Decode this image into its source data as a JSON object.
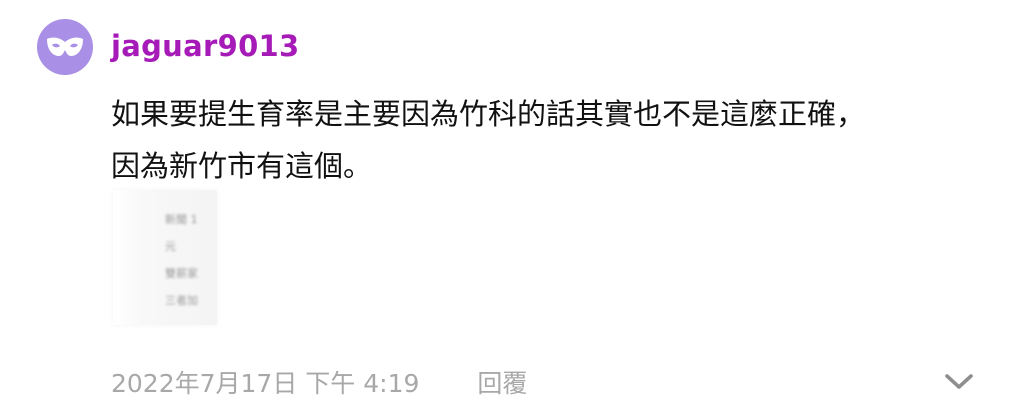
{
  "comment": {
    "username": "jaguar9013",
    "avatar_icon": "mask-icon",
    "avatar_color": "#a98fe6",
    "username_color": "#a61bb8",
    "text_lines": [
      "如果要提生育率是主要因為竹科的話其實也不是這麼正確，",
      "因為新竹市有這個。"
    ],
    "attachment": {
      "blurred_lines": [
        "新聞 1",
        "元",
        "雙薪家",
        "三者加"
      ]
    },
    "meta": {
      "timestamp": "2022年7月17日 下午 4:19",
      "reply_label": "回覆",
      "expand_icon": "chevron-down-icon"
    }
  }
}
